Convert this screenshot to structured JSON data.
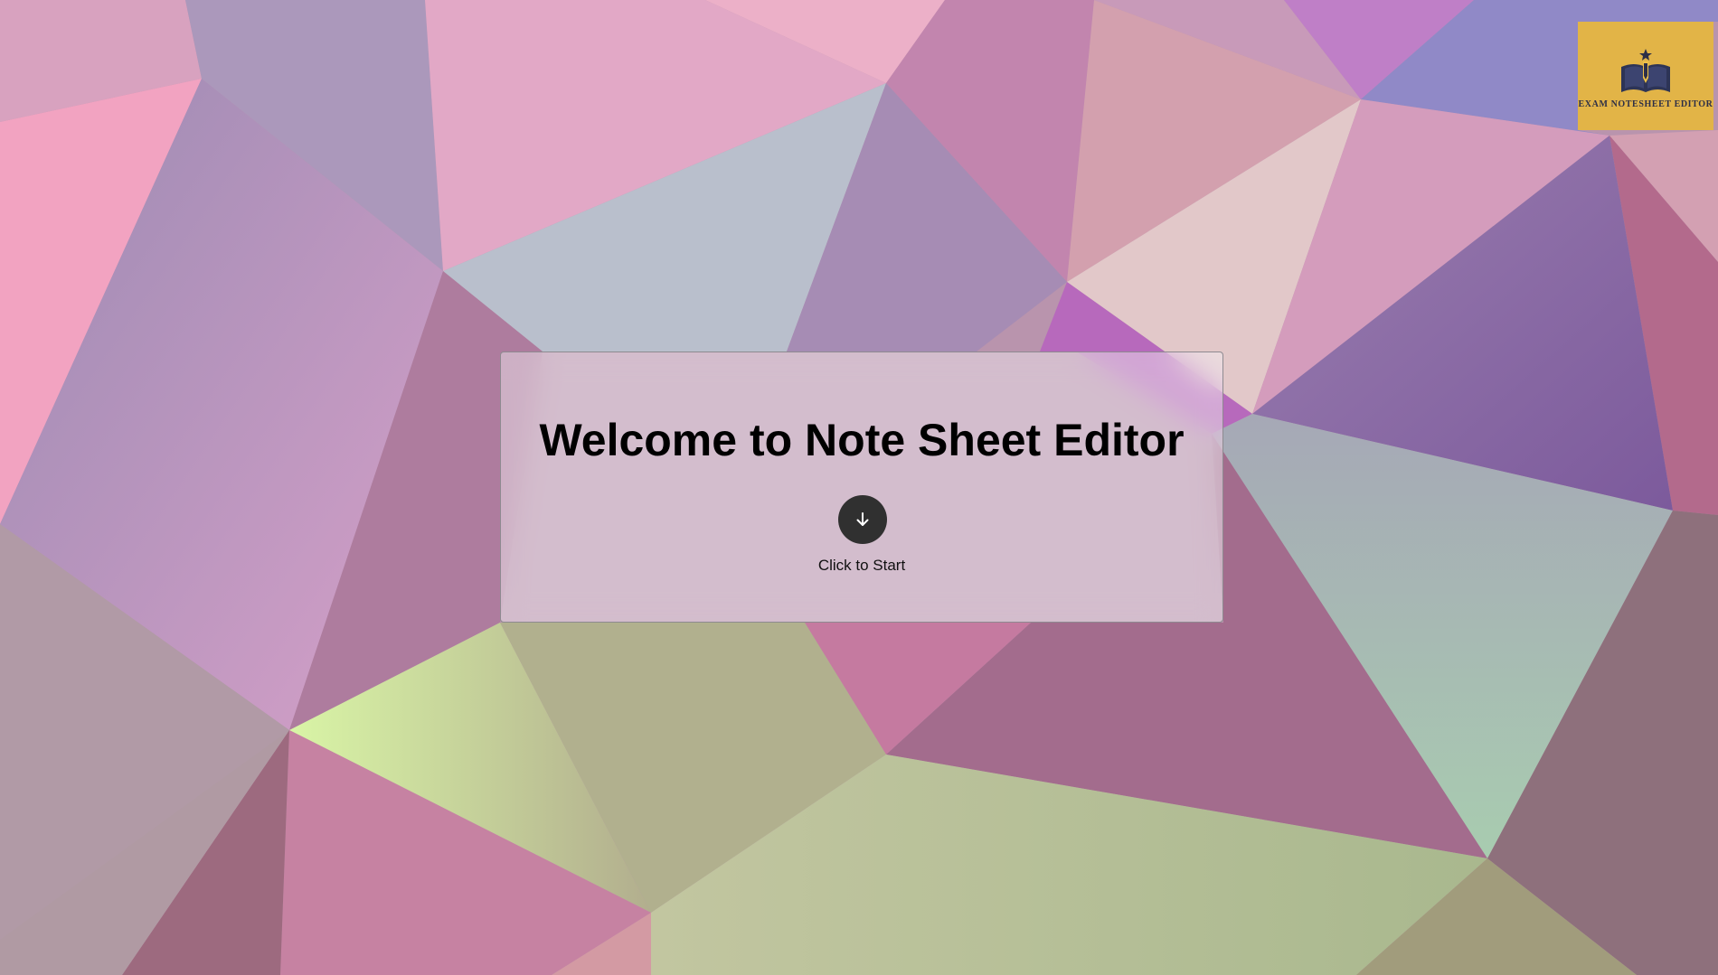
{
  "page": {
    "title": "Welcome to Note Sheet Editor",
    "start_label": "Click to Start"
  },
  "logo": {
    "text": "EXAM NOTESHEET EDITOR",
    "icon": "book-pen-icon",
    "background": "#e2b447"
  },
  "start_button": {
    "icon": "arrow-down-icon",
    "color": "#303030"
  },
  "colors": {
    "card_background": "rgba(245,240,245,0.45)",
    "title_text": "#000000"
  }
}
